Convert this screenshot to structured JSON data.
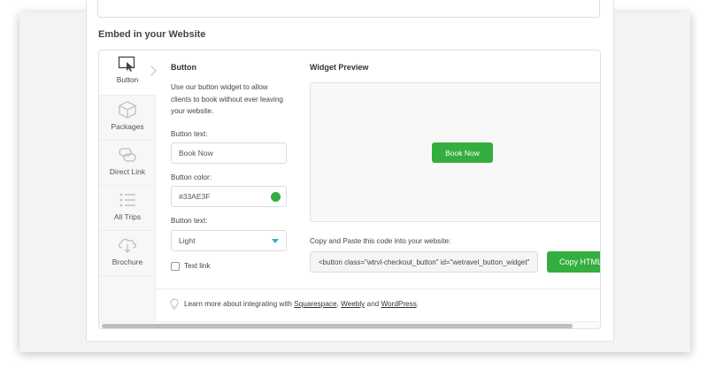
{
  "section": {
    "title": "Embed in your Website"
  },
  "sidebar": {
    "items": [
      {
        "label": "Button",
        "icon": "cursor-click-icon"
      },
      {
        "label": "Packages",
        "icon": "box-icon"
      },
      {
        "label": "Direct Link",
        "icon": "link-icon"
      },
      {
        "label": "All Trips",
        "icon": "list-icon"
      },
      {
        "label": "Brochure",
        "icon": "cloud-download-icon"
      }
    ]
  },
  "form": {
    "heading": "Button",
    "description": "Use our button widget to allow clients to book without ever leaving your website.",
    "button_text_label": "Button text:",
    "button_text_value": "Book Now",
    "button_color_label": "Button color:",
    "button_color_value": "#33AE3F",
    "button_text_style_label": "Button text:",
    "button_text_style_value": "Light",
    "text_link_label": "Text link"
  },
  "preview": {
    "heading": "Widget Preview",
    "button_label": "Book Now"
  },
  "embed": {
    "copy_label": "Copy and Paste this code into your website:",
    "code": "<button class=\"wtrvl-checkout_button\" id=\"wetravel_button_widget\"",
    "copy_button": "Copy HTML"
  },
  "footer": {
    "prefix": "Learn more about integrating with ",
    "squarespace": "Squarespace",
    "comma": ", ",
    "weebly": "Weebly",
    "and": " and ",
    "wordpress": "WordPress",
    "suffix": "."
  },
  "colors": {
    "accent_green": "#33AE3F",
    "dropdown_caret": "#2bb5c5"
  }
}
